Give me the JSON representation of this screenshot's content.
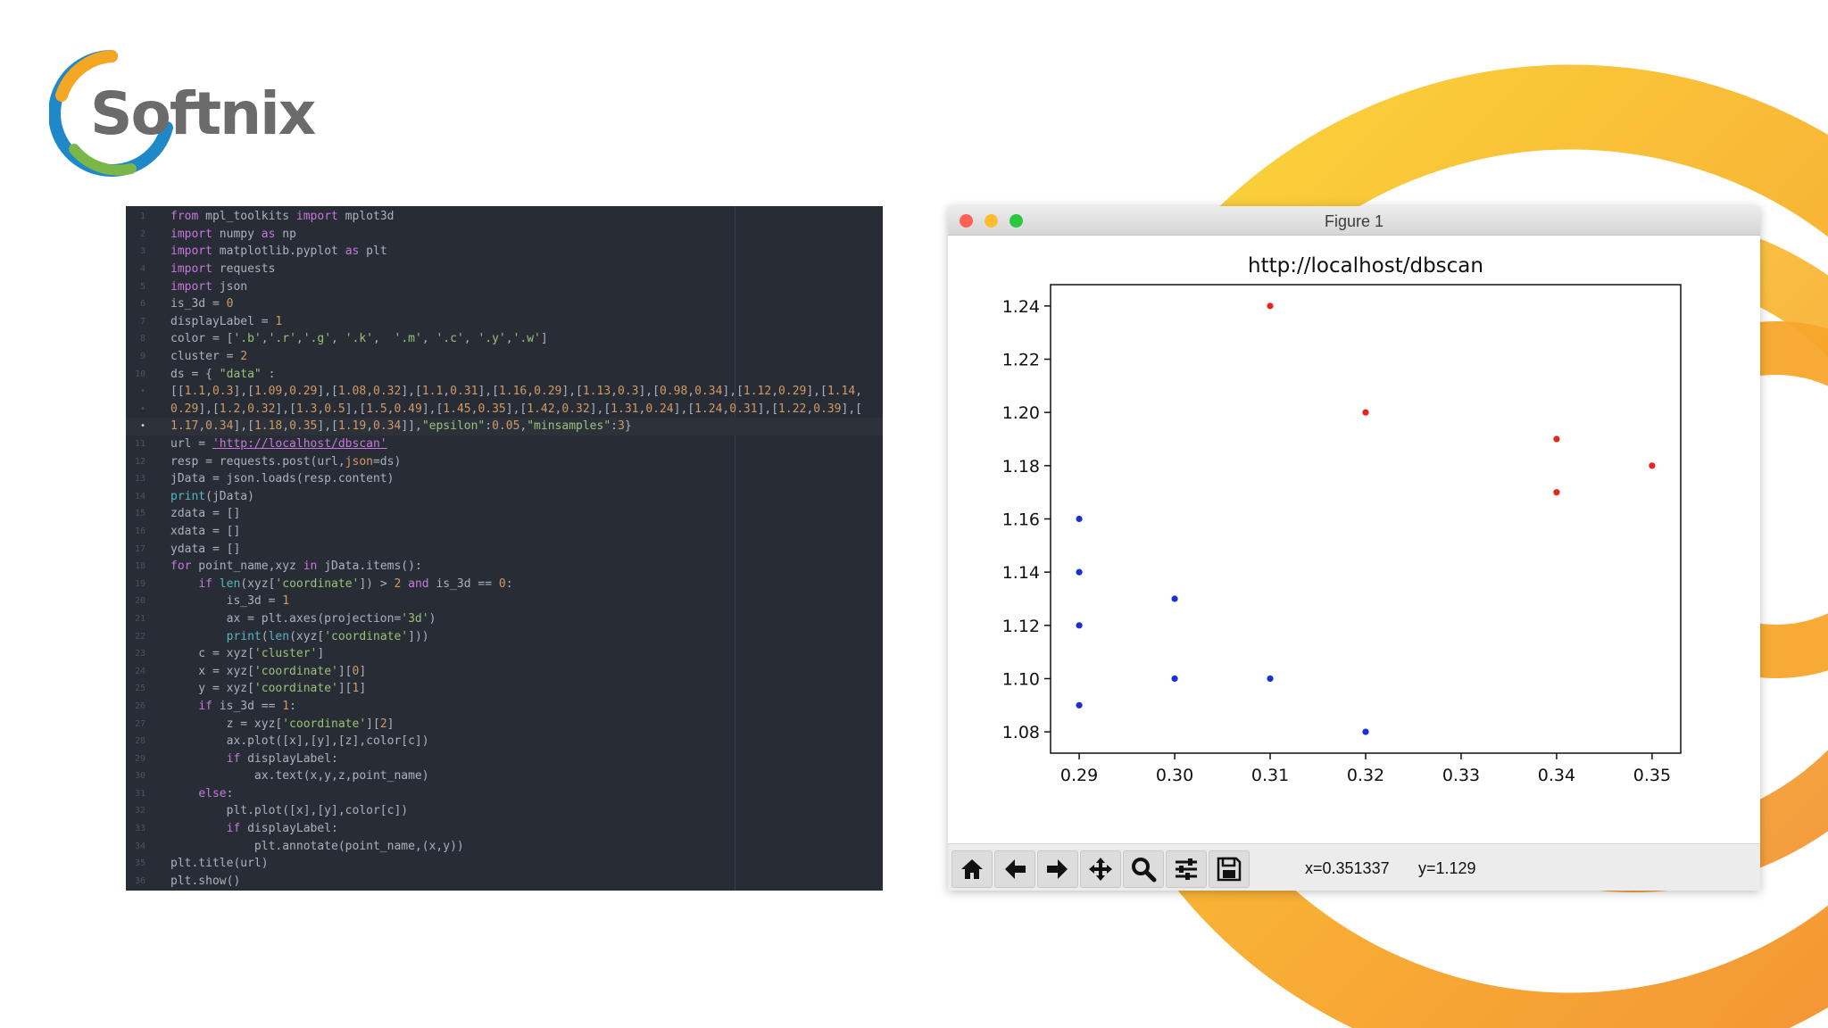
{
  "brand": {
    "name": "Softnix",
    "colors": {
      "orange": "#f5a623",
      "blue": "#1e88c8",
      "green": "#7ab648",
      "text": "#6b6b6b"
    }
  },
  "editor": {
    "theme": {
      "background": "#282c34",
      "keyword": "#c678dd",
      "string": "#98c379",
      "number": "#d19a66",
      "builtin": "#56b6c2",
      "text": "#abb2bf",
      "linenumber": "#4b5263"
    },
    "lines": [
      {
        "num": "1",
        "text": "from mpl_toolkits import mplot3d"
      },
      {
        "num": "2",
        "text": "import numpy as np"
      },
      {
        "num": "3",
        "text": "import matplotlib.pyplot as plt"
      },
      {
        "num": "4",
        "text": "import requests"
      },
      {
        "num": "5",
        "text": "import json"
      },
      {
        "num": "6",
        "text": "is_3d = 0"
      },
      {
        "num": "7",
        "text": "displayLabel = 1"
      },
      {
        "num": "8",
        "text": "color = ['.b','.r','.g', '.k',  '.m', '.c', '.y','.w']"
      },
      {
        "num": "9",
        "text": "cluster = 2"
      },
      {
        "num": "10",
        "text": "ds = { \"data\" :"
      },
      {
        "num": "•",
        "text": "[[1.1,0.3],[1.09,0.29],[1.08,0.32],[1.1,0.31],[1.16,0.29],[1.13,0.3],[0.98,0.34],[1.12,0.29],[1.14,"
      },
      {
        "num": "•",
        "text": "0.29],[1.2,0.32],[1.3,0.5],[1.5,0.49],[1.45,0.35],[1.42,0.32],[1.31,0.24],[1.24,0.31],[1.22,0.39],["
      },
      {
        "num": "•",
        "text": "1.17,0.34],[1.18,0.35],[1.19,0.34]],\"epsilon\":0.05,\"minsamples\":3}"
      },
      {
        "num": "11",
        "text": "url = 'http://localhost/dbscan'"
      },
      {
        "num": "12",
        "text": "resp = requests.post(url,json=ds)"
      },
      {
        "num": "13",
        "text": "jData = json.loads(resp.content)"
      },
      {
        "num": "14",
        "text": "print(jData)"
      },
      {
        "num": "15",
        "text": "zdata = []"
      },
      {
        "num": "16",
        "text": "xdata = []"
      },
      {
        "num": "17",
        "text": "ydata = []"
      },
      {
        "num": "18",
        "text": "for point_name,xyz in jData.items():"
      },
      {
        "num": "19",
        "text": "    if len(xyz['coordinate']) > 2 and is_3d == 0:"
      },
      {
        "num": "20",
        "text": "        is_3d = 1"
      },
      {
        "num": "21",
        "text": "        ax = plt.axes(projection='3d')"
      },
      {
        "num": "22",
        "text": "        print(len(xyz['coordinate']))"
      },
      {
        "num": "23",
        "text": "    c = xyz['cluster']"
      },
      {
        "num": "24",
        "text": "    x = xyz['coordinate'][0]"
      },
      {
        "num": "25",
        "text": "    y = xyz['coordinate'][1]"
      },
      {
        "num": "26",
        "text": "    if is_3d == 1:"
      },
      {
        "num": "27",
        "text": "        z = xyz['coordinate'][2]"
      },
      {
        "num": "28",
        "text": "        ax.plot([x],[y],[z],color[c])"
      },
      {
        "num": "29",
        "text": "        if displayLabel:"
      },
      {
        "num": "30",
        "text": "            ax.text(x,y,z,point_name)"
      },
      {
        "num": "31",
        "text": "    else:"
      },
      {
        "num": "32",
        "text": "        plt.plot([x],[y],color[c])"
      },
      {
        "num": "33",
        "text": "        if displayLabel:"
      },
      {
        "num": "34",
        "text": "            plt.annotate(point_name,(x,y))"
      },
      {
        "num": "35",
        "text": "plt.title(url)"
      },
      {
        "num": "36",
        "text": "plt.show()"
      }
    ]
  },
  "figure_window": {
    "title": "Figure 1",
    "toolbar": {
      "buttons": [
        "home-icon",
        "back-arrow-icon",
        "forward-arrow-icon",
        "pan-icon",
        "zoom-icon",
        "configure-subplots-icon",
        "save-icon"
      ],
      "x_readout": "x=0.351337",
      "y_readout": "y=1.129"
    },
    "traffic_lights": {
      "close": "#fe5f57",
      "minimize": "#febc2e",
      "zoom": "#28c840"
    }
  },
  "chart_data": {
    "type": "scatter",
    "title": "http://localhost/dbscan",
    "xlabel": "",
    "ylabel": "",
    "xlim": [
      0.287,
      0.353
    ],
    "ylim": [
      1.072,
      1.248
    ],
    "xticks": [
      0.29,
      0.3,
      0.31,
      0.32,
      0.33,
      0.34,
      0.35
    ],
    "xtick_labels": [
      "0.29",
      "0.30",
      "0.31",
      "0.32",
      "0.33",
      "0.34",
      "0.35"
    ],
    "yticks": [
      1.08,
      1.1,
      1.12,
      1.14,
      1.16,
      1.18,
      1.2,
      1.22,
      1.24
    ],
    "ytick_labels": [
      "1.08",
      "1.10",
      "1.12",
      "1.14",
      "1.16",
      "1.18",
      "1.20",
      "1.22",
      "1.24"
    ],
    "grid": false,
    "series": [
      {
        "color": "#1a2fd6",
        "points": [
          [
            0.29,
            1.16
          ],
          [
            0.29,
            1.14
          ],
          [
            0.29,
            1.12
          ],
          [
            0.29,
            1.09
          ],
          [
            0.3,
            1.13
          ],
          [
            0.3,
            1.1
          ],
          [
            0.31,
            1.1
          ],
          [
            0.32,
            1.08
          ]
        ]
      },
      {
        "color": "#e8251c",
        "points": [
          [
            0.31,
            1.24
          ],
          [
            0.32,
            1.2
          ],
          [
            0.34,
            1.19
          ],
          [
            0.34,
            1.17
          ],
          [
            0.35,
            1.18
          ]
        ]
      }
    ]
  }
}
